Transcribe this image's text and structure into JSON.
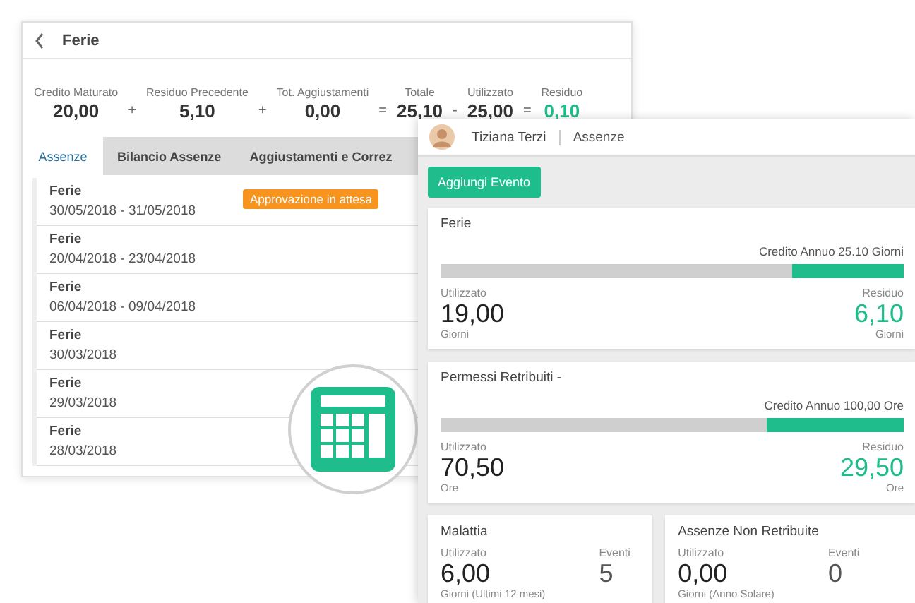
{
  "back_window": {
    "title": "Ferie",
    "summary": [
      {
        "kind": "figure",
        "label": "Credito Maturato",
        "value": "20,00",
        "accent": false
      },
      {
        "kind": "operator",
        "symbol": "+"
      },
      {
        "kind": "figure",
        "label": "Residuo Precedente",
        "value": "5,10",
        "accent": false
      },
      {
        "kind": "operator",
        "symbol": "+"
      },
      {
        "kind": "figure",
        "label": "Tot. Aggiustamenti",
        "value": "0,00",
        "accent": false
      },
      {
        "kind": "operator",
        "symbol": "="
      },
      {
        "kind": "figure",
        "label": "Totale",
        "value": "25,10",
        "accent": false
      },
      {
        "kind": "operator",
        "symbol": "-"
      },
      {
        "kind": "figure",
        "label": "Utilizzato",
        "value": "25,00",
        "accent": false
      },
      {
        "kind": "operator",
        "symbol": "="
      },
      {
        "kind": "figure",
        "label": "Residuo",
        "value": "0,10",
        "accent": true
      }
    ],
    "tabs": [
      {
        "label": "Assenze",
        "selected": true
      },
      {
        "label": "Bilancio Assenze",
        "selected": false
      },
      {
        "label": "Aggiustamenti e Correz",
        "selected": false
      }
    ],
    "events": [
      {
        "title": "Ferie",
        "dates": "30/05/2018 - 31/05/2018",
        "badge": "Approvazione in attesa"
      },
      {
        "title": "Ferie",
        "dates": "20/04/2018 - 23/04/2018"
      },
      {
        "title": "Ferie",
        "dates": "06/04/2018 - 09/04/2018"
      },
      {
        "title": "Ferie",
        "dates": "30/03/2018"
      },
      {
        "title": "Ferie",
        "dates": "29/03/2018"
      },
      {
        "title": "Ferie",
        "dates": "28/03/2018"
      }
    ]
  },
  "front_window": {
    "user": "Tiziana Terzi",
    "section": "Assenze",
    "add_button": "Aggiungi Evento",
    "balances": [
      {
        "title": "Ferie",
        "credit": "Credito Annuo 25.10 Giorni",
        "level": 0.24,
        "used_label": "Utilizzato",
        "used": "19,00",
        "used_unit": "Giorni",
        "remaining_label": "Residuo",
        "remaining": "6,10",
        "remaining_unit": "Giorni"
      },
      {
        "title": "Permessi Retribuiti -",
        "credit": "Credito Annuo 100,00 Ore",
        "level": 0.295,
        "used_label": "Utilizzato",
        "used": "70,50",
        "used_unit": "Ore",
        "remaining_label": "Residuo",
        "remaining": "29,50",
        "remaining_unit": "Ore"
      }
    ],
    "counters": [
      {
        "title": "Malattia",
        "used_label": "Utilizzato",
        "used": "6,00",
        "used_unit": "Giorni (Ultimi 12 mesi)",
        "events_label": "Eventi",
        "events": "5"
      },
      {
        "title": "Assenze Non Retribuite",
        "used_label": "Utilizzato",
        "used": "0,00",
        "used_unit": "Giorni (Anno Solare)",
        "events_label": "Eventi",
        "events": "0"
      }
    ]
  }
}
